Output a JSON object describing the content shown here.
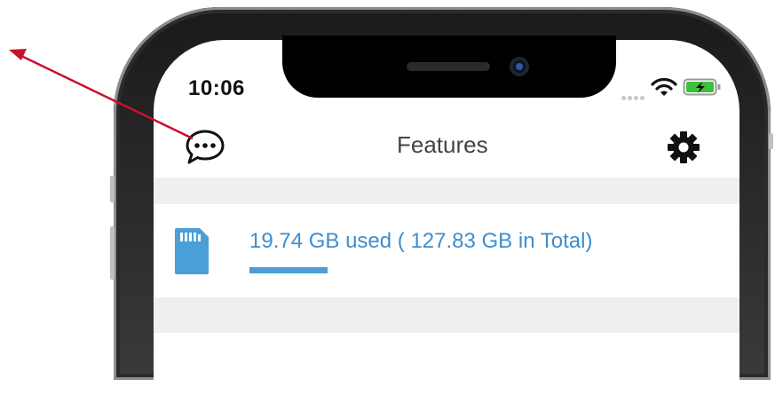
{
  "status_bar": {
    "time": "10:06",
    "icons": [
      "cell-signal-dots",
      "wifi-icon",
      "battery-charging-icon"
    ],
    "battery_color": "#3cc13b"
  },
  "header": {
    "title": "Features",
    "left_icon": "chat-bubble-icon",
    "right_icon": "gear-icon"
  },
  "storage": {
    "icon": "sd-card-icon",
    "label": "19.74 GB used ( 127.83 GB in Total)",
    "used_gb": 19.74,
    "total_gb": 127.83,
    "accent_color": "#3d8ed0"
  },
  "annotation": {
    "arrow_color": "#c8102e"
  }
}
